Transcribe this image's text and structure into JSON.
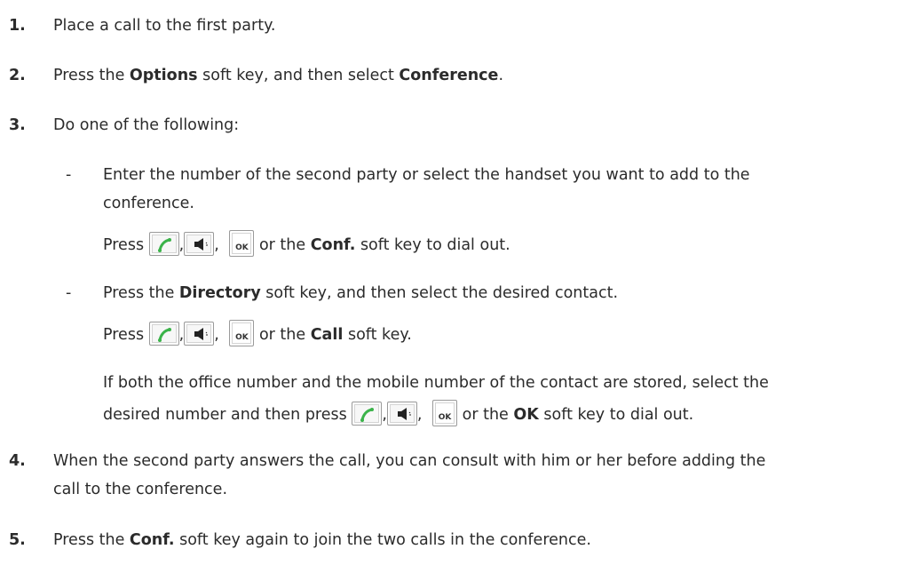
{
  "steps": [
    {
      "num": "1.",
      "text": "Place a call to the first party."
    },
    {
      "num": "2.",
      "pre": "Press the ",
      "b1": "Options",
      "mid": " soft key, and then select ",
      "b2": "Conference",
      "post": "."
    },
    {
      "num": "3.",
      "text": "Do one of the following:"
    },
    {
      "num": "4.",
      "line1": "When the second party answers the call, you can consult with him or her before adding the",
      "line2": "call to the conference."
    },
    {
      "num": "5.",
      "pre": "Press the ",
      "bold": "Conf.",
      "post": " soft key again to join the two calls in the conference."
    }
  ],
  "options": [
    {
      "dash": "-",
      "line1": "Enter the number of the second party or select the handset you want to add to the",
      "line2": "conference.",
      "press_pre": "Press",
      "comma": ",",
      "or_the": "or the",
      "bold": "Conf.",
      "press_post": "soft key to dial out."
    },
    {
      "dash": "-",
      "pre": "Press the ",
      "bold": "Directory",
      "post": " soft key, and then select the desired contact.",
      "press_pre": "Press",
      "comma": ",",
      "or_the": "or the",
      "press_bold": "Call",
      "press_post": "soft key.",
      "note_line1": "If both the office number and the mobile number of the contact are stored, select the",
      "note_pre": "desired number and then press",
      "note_bold": "OK",
      "note_post": "soft key to dial out."
    }
  ],
  "icons": {
    "call": "handset-off-hook-icon",
    "speaker": "speakerphone-icon",
    "ok": "ok-key-icon",
    "ok_label": "OK",
    "call_color": "#3bb34a"
  }
}
